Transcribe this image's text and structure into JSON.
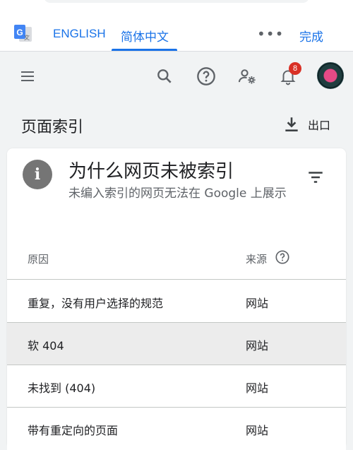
{
  "translate_bar": {
    "tab_english": "ENGLISH",
    "tab_chinese": "简体中文",
    "more": "•••",
    "done": "完成"
  },
  "header": {
    "notification_count": "8",
    "icons": [
      "menu-icon",
      "search-icon",
      "help-icon",
      "admin-settings-icon",
      "bell-icon"
    ]
  },
  "page": {
    "title": "页面索引",
    "export_label": "出口"
  },
  "card": {
    "title": "为什么网页未被索引",
    "subtitle": "未编入索引的网页无法在 Google 上展示",
    "columns": {
      "reason": "原因",
      "source": "来源"
    },
    "rows": [
      {
        "reason": "重复，没有用户选择的规范",
        "source": "网站",
        "highlighted": false
      },
      {
        "reason": "软 404",
        "source": "网站",
        "highlighted": true
      },
      {
        "reason": "未找到 (404)",
        "source": "网站",
        "highlighted": false
      },
      {
        "reason": "带有重定向的页面",
        "source": "网站",
        "highlighted": false
      }
    ]
  },
  "colors": {
    "accent": "#1a73e8",
    "badge": "#d93025",
    "background": "#f1f3f4"
  }
}
